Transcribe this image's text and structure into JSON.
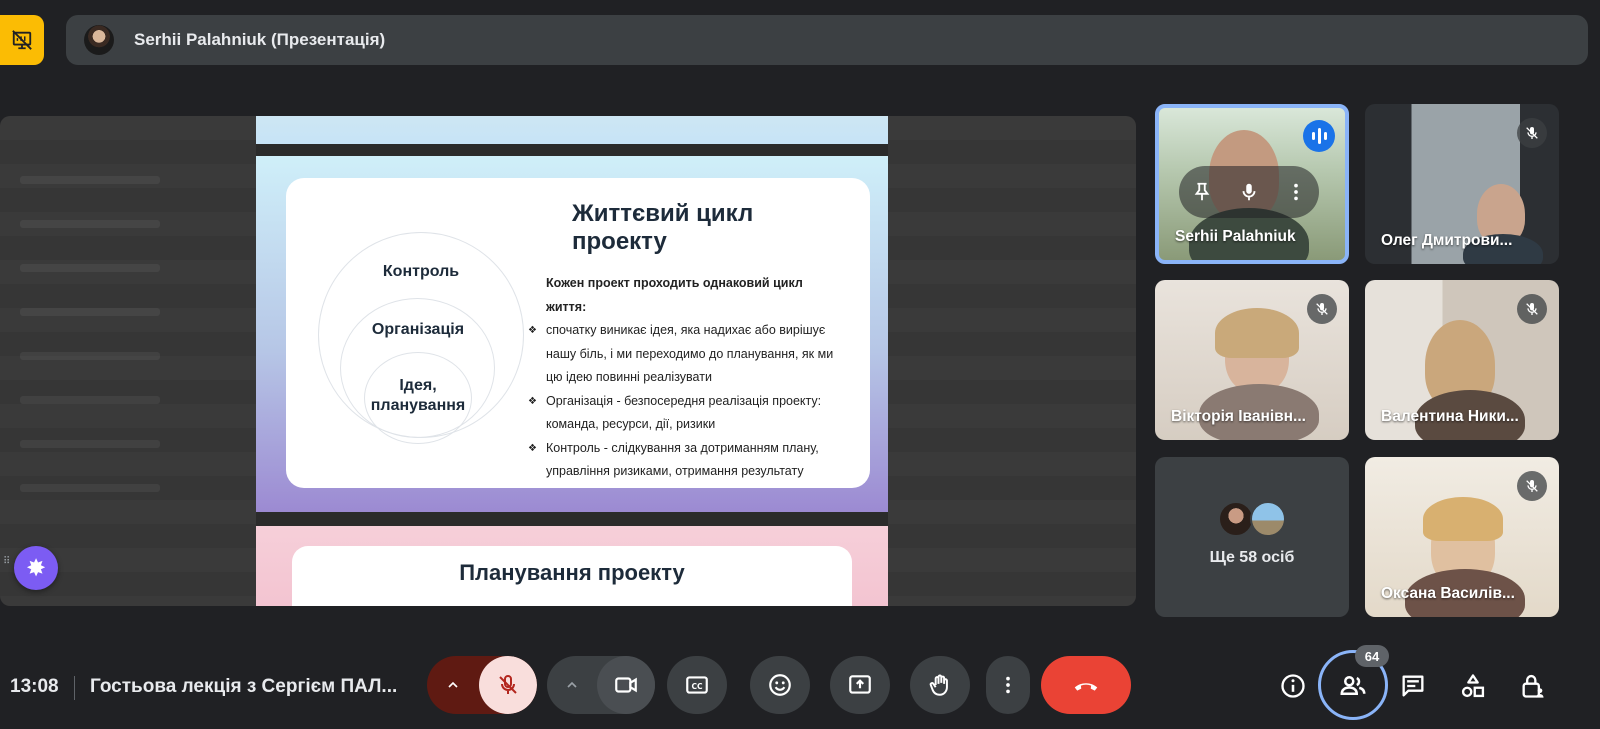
{
  "presentation": {
    "title": "Serhii Palahniuk (Презентація)"
  },
  "slide": {
    "title": "Життєвий цикл проекту",
    "circles": [
      "Контроль",
      "Організація",
      "Ідея,",
      "планування"
    ],
    "intro": "Кожен проект проходить однаковий цикл життя:",
    "bullets": [
      "спочатку виникає ідея, яка надихає або вирішує нашу біль, і ми переходимо до планування, як ми цю ідею повинні реалізувати",
      "Організація - безпосередня реалізація проекту: команда, ресурси, дії, ризики",
      "Контроль - слідкування за дотриманням плану, управління ризиками, отримання результату"
    ],
    "next_title": "Планування проекту"
  },
  "participants": [
    {
      "name": "Serhii Palahniuk"
    },
    {
      "name": "Олег Дмитрови..."
    },
    {
      "name": "Вікторія Іванівн..."
    },
    {
      "name": "Валентина Ники..."
    },
    {
      "name": "Оксана Василів..."
    }
  ],
  "more_participants": "Ще 58 осіб",
  "bottom": {
    "time": "13:08",
    "meeting_title": "Гостьова лекція з Сергієм ПАЛ...",
    "people_count": "64"
  },
  "colors": {
    "accent": "#8ab4f8",
    "end_call": "#ea4335",
    "mic_muted_bg": "#f9dedc",
    "present_badge": "#fbbc04",
    "effects": "#7c5cf3"
  }
}
